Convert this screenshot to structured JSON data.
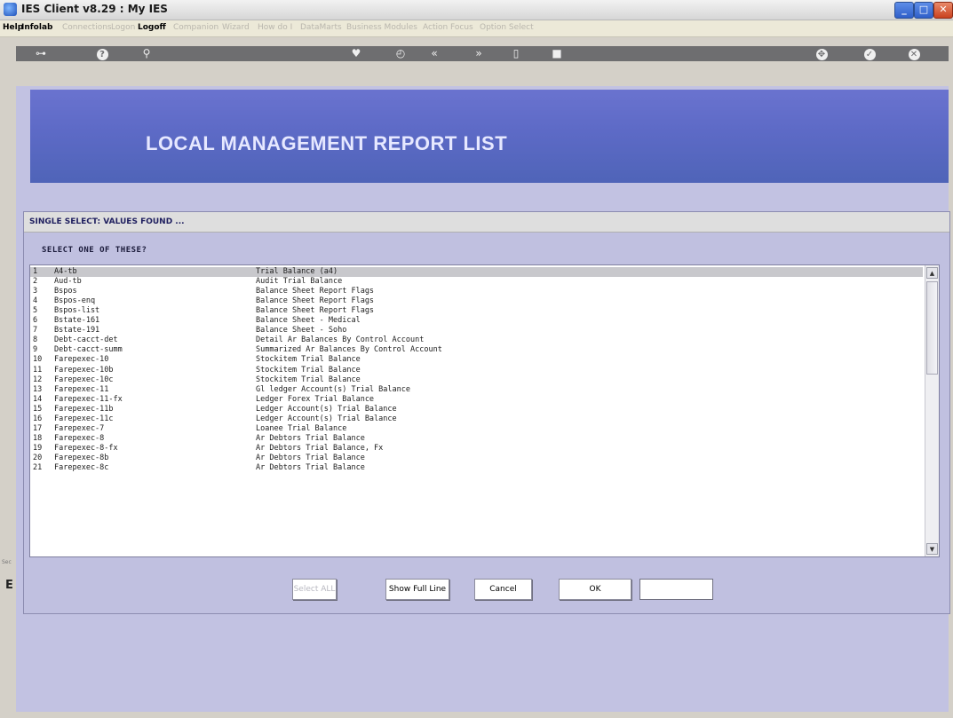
{
  "window": {
    "title": "IES Client v8.29 : My IES"
  },
  "menubar": {
    "items": [
      {
        "label": "Help",
        "active": true
      },
      {
        "label": "Infolab",
        "active": true
      },
      {
        "label": "Connections",
        "active": false
      },
      {
        "label": "Logon",
        "active": false
      },
      {
        "label": "Logoff",
        "active": true
      },
      {
        "label": "Companion",
        "active": false
      },
      {
        "label": "Wizard",
        "active": false
      },
      {
        "label": "How do I",
        "active": false
      },
      {
        "label": "DataMarts",
        "active": false
      },
      {
        "label": "Business Modules",
        "active": false
      },
      {
        "label": "Action Focus",
        "active": false
      },
      {
        "label": "Option Select",
        "active": false
      }
    ]
  },
  "banner": {
    "title": "LOCAL MANAGEMENT REPORT LIST"
  },
  "dialog": {
    "title": "SINGLE SELECT: VALUES FOUND ...",
    "prompt": "SELECT ONE OF THESE?",
    "rows": [
      {
        "num": "1",
        "code": "A4-tb",
        "desc": "Trial Balance (a4)",
        "selected": true
      },
      {
        "num": "2",
        "code": "Aud-tb",
        "desc": "Audit Trial Balance"
      },
      {
        "num": "3",
        "code": "Bspos",
        "desc": "Balance Sheet Report Flags"
      },
      {
        "num": "4",
        "code": "Bspos-enq",
        "desc": "Balance Sheet Report Flags"
      },
      {
        "num": "5",
        "code": "Bspos-list",
        "desc": "Balance Sheet Report Flags"
      },
      {
        "num": "6",
        "code": "Bstate-161",
        "desc": "Balance Sheet - Medical"
      },
      {
        "num": "7",
        "code": "Bstate-191",
        "desc": "Balance Sheet - Soho"
      },
      {
        "num": "8",
        "code": "Debt-cacct-det",
        "desc": "Detail Ar Balances By Control Account"
      },
      {
        "num": "9",
        "code": "Debt-cacct-summ",
        "desc": "Summarized Ar Balances By Control Account"
      },
      {
        "num": "10",
        "code": "Farepexec-10",
        "desc": "Stockitem Trial Balance"
      },
      {
        "num": "11",
        "code": "Farepexec-10b",
        "desc": "Stockitem Trial Balance"
      },
      {
        "num": "12",
        "code": "Farepexec-10c",
        "desc": "Stockitem Trial Balance"
      },
      {
        "num": "13",
        "code": "Farepexec-11",
        "desc": "Gl ledger Account(s) Trial Balance"
      },
      {
        "num": "14",
        "code": "Farepexec-11-fx",
        "desc": "Ledger Forex Trial Balance"
      },
      {
        "num": "15",
        "code": "Farepexec-11b",
        "desc": "Ledger Account(s) Trial Balance"
      },
      {
        "num": "16",
        "code": "Farepexec-11c",
        "desc": "Ledger Account(s) Trial Balance"
      },
      {
        "num": "17",
        "code": "Farepexec-7",
        "desc": "Loanee Trial Balance"
      },
      {
        "num": "18",
        "code": "Farepexec-8",
        "desc": "Ar Debtors Trial Balance"
      },
      {
        "num": "19",
        "code": "Farepexec-8-fx",
        "desc": "Ar Debtors Trial Balance, Fx"
      },
      {
        "num": "20",
        "code": "Farepexec-8b",
        "desc": "Ar Debtors Trial Balance"
      },
      {
        "num": "21",
        "code": "Farepexec-8c",
        "desc": "Ar Debtors Trial Balance"
      }
    ],
    "buttons": {
      "select_all": "Select ALL",
      "show_full_line": "Show Full Line",
      "cancel": "Cancel",
      "ok": "OK"
    },
    "ok_field_value": ""
  },
  "side": {
    "label": "Sec",
    "glyph": "E"
  }
}
